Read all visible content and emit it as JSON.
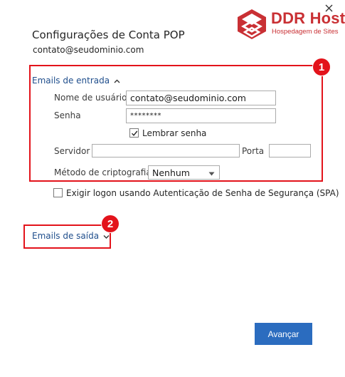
{
  "window": {
    "close_icon": "close-icon"
  },
  "logo": {
    "title": "DDR Host",
    "subtitle": "Hospedagem de Sites",
    "brand_color": "#c93034"
  },
  "header": {
    "title": "Configurações de Conta POP",
    "email": "contato@seudominio.com"
  },
  "annotations": {
    "highlight_color": "#e3131b",
    "badge_1": "1",
    "badge_2": "2"
  },
  "incoming": {
    "section_label": "Emails de entrada",
    "expanded": true,
    "chevron_icon": "chevron-up-icon",
    "username_label": "Nome de usuário",
    "username_value": "contato@seudominio.com",
    "password_label": "Senha",
    "password_value": "********",
    "remember_label": "Lembrar senha",
    "remember_checked": true,
    "server_label": "Servidor",
    "server_value": "",
    "port_label": "Porta",
    "port_value": "",
    "encryption_label": "Método de criptografia",
    "encryption_value": "Nenhum"
  },
  "spa": {
    "label": "Exigir logon usando Autenticação de Senha de Segurança (SPA)",
    "checked": false
  },
  "outgoing": {
    "section_label": "Emails de saída",
    "expanded": false,
    "chevron_icon": "chevron-down-icon"
  },
  "actions": {
    "next_label": "Avançar",
    "accent_color": "#2b6cbf"
  }
}
